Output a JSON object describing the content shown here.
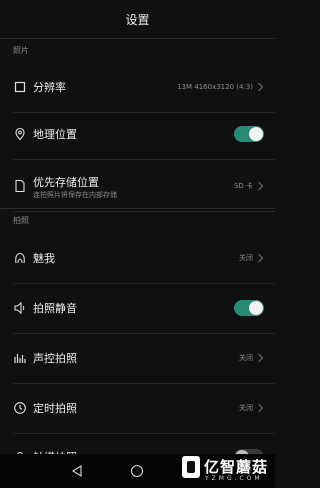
{
  "header": {
    "title": "设置"
  },
  "sections": [
    {
      "label": "照片"
    },
    {
      "label": "拍照"
    }
  ],
  "rows": [
    {
      "label": "分辨率",
      "icon": "square-icon",
      "value": "13M 4160x3120 (4:3)"
    },
    {
      "label": "地理位置",
      "icon": "location-pin-icon",
      "toggle": true
    },
    {
      "label": "优先存储位置",
      "sublabel": "连拍照片将保存在内部存储",
      "icon": "file-icon",
      "value": "SD 卡"
    },
    {
      "label": "魅我",
      "icon": "face-beauty-icon",
      "value": "关闭"
    },
    {
      "label": "拍照静音",
      "icon": "speaker-icon",
      "toggle": true
    },
    {
      "label": "声控拍照",
      "icon": "sound-bars-icon",
      "value": "关闭"
    },
    {
      "label": "定时拍照",
      "icon": "clock-icon",
      "value": "关闭"
    },
    {
      "label": "触摸拍照",
      "icon": "touch-icon",
      "toggle": false
    }
  ],
  "colors": {
    "background": "#101010",
    "toggle_on": "#2a8a76",
    "secondary_text": "#8a8a8a"
  },
  "navbar": {
    "icons": [
      "back-triangle-icon",
      "home-circle-icon"
    ]
  },
  "watermark": {
    "text": "亿智蘑菇",
    "sub": "YZMG.COM"
  }
}
